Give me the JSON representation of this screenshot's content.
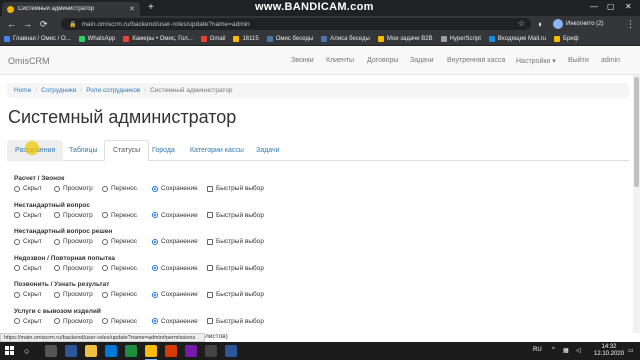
{
  "browser": {
    "tab_title": "Системный администратор",
    "new_tab": "+",
    "watermark": "www.BANDICAM.com",
    "url": "main.omiscrm.ru/backend/user-roles/update?name=admin",
    "profile": "Инкогнито (2)",
    "bookmarks": [
      {
        "label": "Главная / Омис / О...",
        "color": "#4285f4"
      },
      {
        "label": "WhatsApp",
        "color": "#25d366"
      },
      {
        "label": "Камеры • Омис, Гол...",
        "color": "#ea4335"
      },
      {
        "label": "Gmail",
        "color": "#ea4335"
      },
      {
        "label": "16115",
        "color": "#fbbc05"
      },
      {
        "label": "Омис беседы",
        "color": "#4a76a8"
      },
      {
        "label": "Алиса беседы",
        "color": "#4a76a8"
      },
      {
        "label": "Мои задачи B2B",
        "color": "#fbbc05"
      },
      {
        "label": "HyperScript",
        "color": "#9aa0a6"
      },
      {
        "label": "Входящие Mail.ru",
        "color": "#168de2"
      },
      {
        "label": "Бриф",
        "color": "#fbbc05"
      }
    ]
  },
  "site": {
    "brand": "OmisCRM",
    "nav": [
      "Звонки",
      "Клиенты",
      "Договоры",
      "Задачи",
      "Внутренняя касса",
      "Настройки ▾",
      "Выйти",
      "admin"
    ]
  },
  "breadcrumb": {
    "home": "Home",
    "staff": "Сотрудники",
    "roles": "Роли сотрудников",
    "current": "Системный администратор"
  },
  "page_title": "Системный администратор",
  "tabs": [
    "Разрешения",
    "Таблицы",
    "Статусы",
    "Города",
    "Категории кассы",
    "Задачи"
  ],
  "active_tab": "Статусы",
  "options": {
    "hidden": "Скрыт",
    "view": "Просмотр",
    "transfer": "Перенос",
    "save": "Сохранение",
    "quick": "Быстрый выбор"
  },
  "groups": [
    {
      "title": "Расчет / Звонок",
      "selected": "save"
    },
    {
      "title": "Нестандартный вопрос",
      "selected": "save"
    },
    {
      "title": "Нестандартный вопрос решен",
      "selected": "save"
    },
    {
      "title": "Недозвон / Повторная попытка",
      "selected": "save"
    },
    {
      "title": "Позвонить / Узнать результат",
      "selected": "save"
    },
    {
      "title": "Услуги с вывозом изделий",
      "selected": "save"
    }
  ],
  "status_url": "https://main.omiscrm.ru/backend/user-roles/update?name=admin#permissions",
  "status_tail": "листов)",
  "taskbar": {
    "lang": "RU",
    "time": "14:32",
    "date": "12.10.2020"
  }
}
